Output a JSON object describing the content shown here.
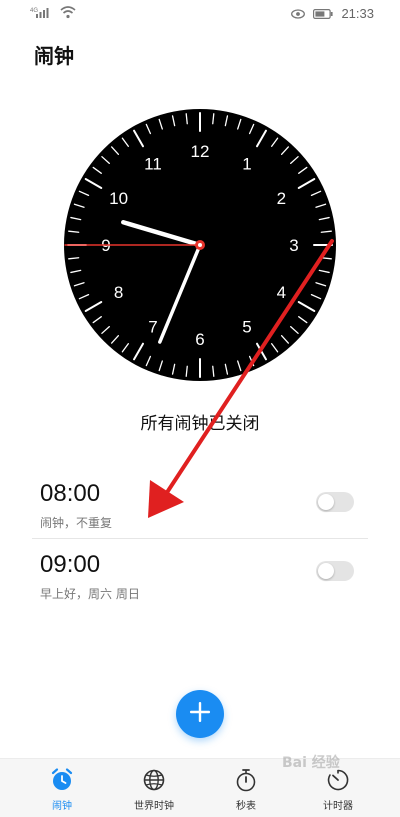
{
  "status_bar": {
    "signal_label": "4G",
    "time": "21:33",
    "icons": [
      "signal-icon",
      "wifi-icon",
      "eye-icon",
      "battery-icon"
    ]
  },
  "page_title": "闹钟",
  "clock": {
    "numerals": [
      "12",
      "1",
      "2",
      "3",
      "4",
      "5",
      "6",
      "7",
      "8",
      "9",
      "10",
      "11"
    ],
    "time_shown": "21:33",
    "face_color": "#000000",
    "hand_color": "#ffffff",
    "second_hand_color": "#e8342c"
  },
  "alarm_status": "所有闹钟已关闭",
  "alarms": [
    {
      "time": "08:00",
      "description": "闹钟，不重复",
      "enabled": false
    },
    {
      "time": "09:00",
      "description": "早上好，周六 周日",
      "enabled": false
    }
  ],
  "fab": {
    "icon": "plus-icon"
  },
  "bottom_nav": [
    {
      "label": "闹钟",
      "icon": "alarm-clock-icon",
      "active": true
    },
    {
      "label": "世界时钟",
      "icon": "globe-icon",
      "active": false
    },
    {
      "label": "秒表",
      "icon": "stopwatch-icon",
      "active": false
    },
    {
      "label": "计时器",
      "icon": "timer-icon",
      "active": false
    }
  ],
  "colors": {
    "accent": "#1a8cf2",
    "annotation_arrow": "#e02020"
  },
  "watermark": "Bai 经验"
}
